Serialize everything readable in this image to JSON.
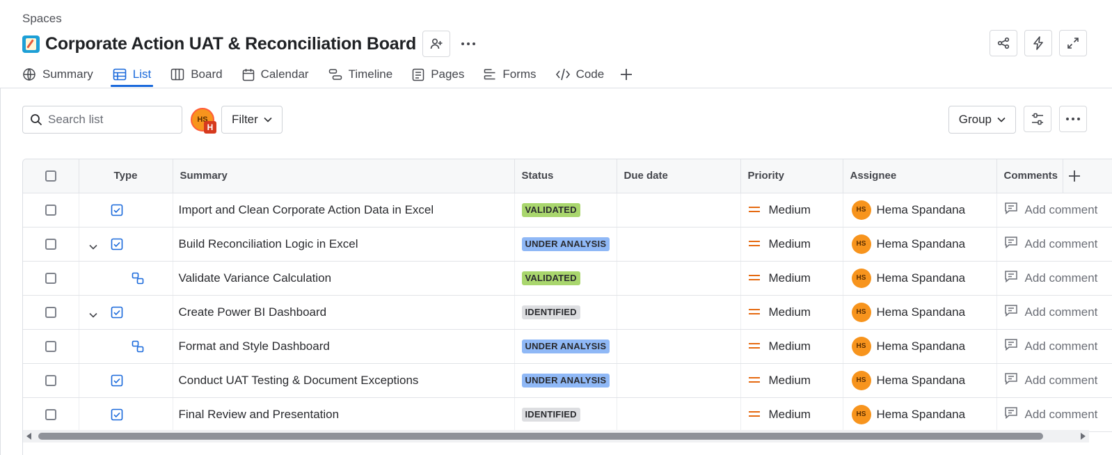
{
  "breadcrumb": "Spaces",
  "title": "Corporate Action UAT & Reconciliation Board",
  "title_icons": {
    "space_logo": "memo-icon",
    "add_people": "person-add-icon",
    "more": "more-icon"
  },
  "top_actions": [
    {
      "name": "share-button",
      "icon": "share-icon"
    },
    {
      "name": "automation-button",
      "icon": "lightning-icon"
    },
    {
      "name": "fullscreen-button",
      "icon": "expand-icon"
    }
  ],
  "tabs": [
    {
      "label": "Summary",
      "icon": "globe-icon",
      "active": false
    },
    {
      "label": "List",
      "icon": "list-icon",
      "active": true
    },
    {
      "label": "Board",
      "icon": "board-icon",
      "active": false
    },
    {
      "label": "Calendar",
      "icon": "calendar-icon",
      "active": false
    },
    {
      "label": "Timeline",
      "icon": "timeline-icon",
      "active": false
    },
    {
      "label": "Pages",
      "icon": "pages-icon",
      "active": false
    },
    {
      "label": "Forms",
      "icon": "forms-icon",
      "active": false
    },
    {
      "label": "Code",
      "icon": "code-icon",
      "active": false
    }
  ],
  "toolbar": {
    "search_placeholder": "Search list",
    "avatar_initials": "HS",
    "avatar_badge": "H",
    "filter_label": "Filter",
    "group_label": "Group"
  },
  "columns": [
    "Type",
    "Summary",
    "Status",
    "Due date",
    "Priority",
    "Assignee",
    "Comments"
  ],
  "rows": [
    {
      "type": "task",
      "expandable": false,
      "summary": "Import and Clean Corporate Action Data in Excel",
      "status": "VALIDATED",
      "status_color": "green",
      "due": "",
      "priority": "Medium",
      "assignee": "Hema Spandana",
      "assignee_initials": "HS",
      "comment": "Add comment"
    },
    {
      "type": "task",
      "expandable": true,
      "summary": "Build Reconciliation Logic in Excel",
      "status": "UNDER ANALYSIS",
      "status_color": "blue",
      "due": "",
      "priority": "Medium",
      "assignee": "Hema Spandana",
      "assignee_initials": "HS",
      "comment": "Add comment"
    },
    {
      "type": "subtask",
      "expandable": false,
      "summary": "Validate Variance Calculation",
      "status": "VALIDATED",
      "status_color": "green",
      "due": "",
      "priority": "Medium",
      "assignee": "Hema Spandana",
      "assignee_initials": "HS",
      "comment": "Add comment"
    },
    {
      "type": "task",
      "expandable": true,
      "summary": "Create Power BI Dashboard",
      "status": "IDENTIFIED",
      "status_color": "gray",
      "due": "",
      "priority": "Medium",
      "assignee": "Hema Spandana",
      "assignee_initials": "HS",
      "comment": "Add comment"
    },
    {
      "type": "subtask",
      "expandable": false,
      "summary": "Format and Style Dashboard",
      "status": "UNDER ANALYSIS",
      "status_color": "blue",
      "due": "",
      "priority": "Medium",
      "assignee": "Hema Spandana",
      "assignee_initials": "HS",
      "comment": "Add comment"
    },
    {
      "type": "task",
      "expandable": false,
      "summary": "Conduct UAT Testing & Document Exceptions",
      "status": "UNDER ANALYSIS",
      "status_color": "blue",
      "due": "",
      "priority": "Medium",
      "assignee": "Hema Spandana",
      "assignee_initials": "HS",
      "comment": "Add comment"
    },
    {
      "type": "task",
      "expandable": false,
      "summary": "Final Review and Presentation",
      "status": "IDENTIFIED",
      "status_color": "gray",
      "due": "",
      "priority": "Medium",
      "assignee": "Hema Spandana",
      "assignee_initials": "HS",
      "comment": "Add comment"
    }
  ],
  "colors": {
    "accent": "#1868db",
    "status_green": "#a9d66d",
    "status_blue": "#8fb8f6",
    "status_gray": "#dddee1",
    "priority_medium": "#e56910",
    "avatar": "#f7941d"
  }
}
